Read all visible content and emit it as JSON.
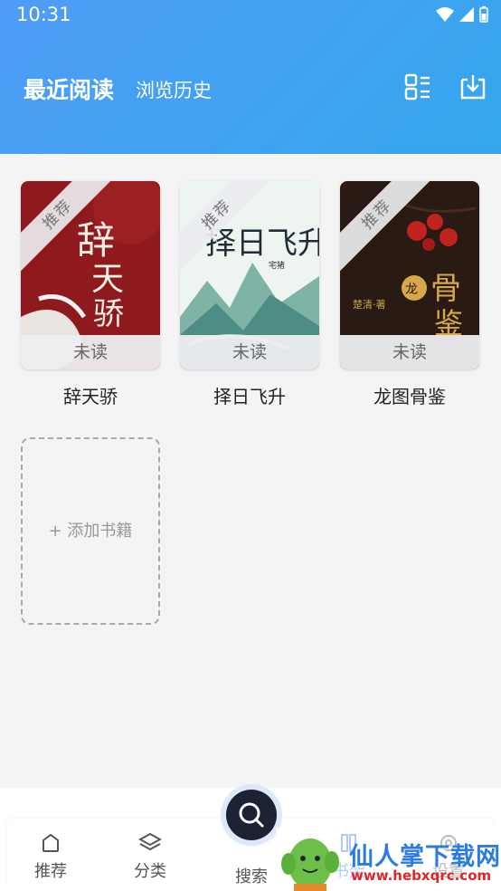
{
  "status": {
    "time": "10:31"
  },
  "header": {
    "title": "最近阅读",
    "subtitle": "浏览历史",
    "icons": [
      "list-grid-icon",
      "download-icon"
    ]
  },
  "books": [
    {
      "title": "辞天骄",
      "badge": "推荐",
      "status": "未读",
      "cover_color": "#8e1a1d"
    },
    {
      "title": "择日飞升",
      "badge": "推荐",
      "status": "未读",
      "cover_color": "#e9f1ec"
    },
    {
      "title": "龙图骨鉴",
      "badge": "推荐",
      "status": "未读",
      "cover_color": "#2a1a14"
    }
  ],
  "add_book_label": "+ 添加书籍",
  "nav": {
    "items": [
      {
        "label": "推荐",
        "icon": "home-icon"
      },
      {
        "label": "分类",
        "icon": "layers-icon"
      },
      {
        "label": "搜索",
        "icon": "search-icon"
      },
      {
        "label": "书架",
        "icon": "bookshelf-icon"
      },
      {
        "label": "设置",
        "icon": "settings-icon"
      }
    ]
  },
  "watermark": {
    "name": "仙人掌下载网",
    "url": "www.hebxqrc.com"
  },
  "colors": {
    "header_start": "#4f9cf6",
    "header_end": "#35a6ee",
    "fab": "#1b2234"
  }
}
